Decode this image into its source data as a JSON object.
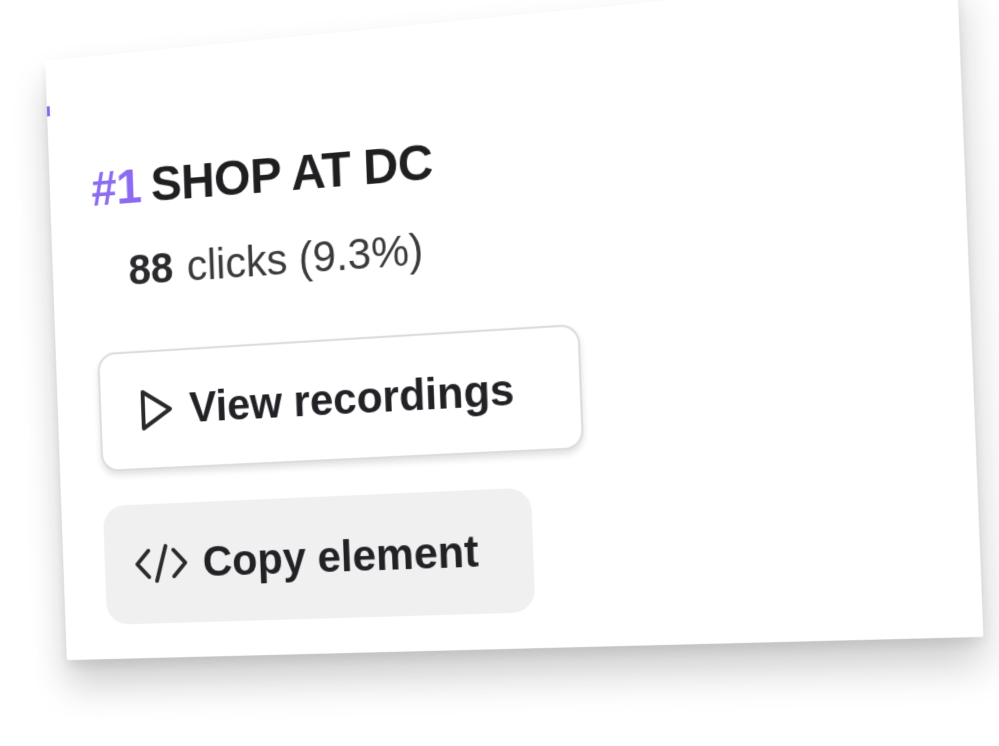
{
  "item": {
    "rank": "#1",
    "title": "SHOP AT DC",
    "clicks_count": "88",
    "clicks_text": "clicks (9.3%)"
  },
  "actions": {
    "view_recordings_label": "View recordings",
    "copy_element_label": "Copy element"
  },
  "icons": {
    "view": "play-icon",
    "copy": "code-icon"
  },
  "colors": {
    "accent": "#8b6bf2",
    "text": "#1f1f22",
    "secondary_button_bg": "#f0f0f1"
  }
}
